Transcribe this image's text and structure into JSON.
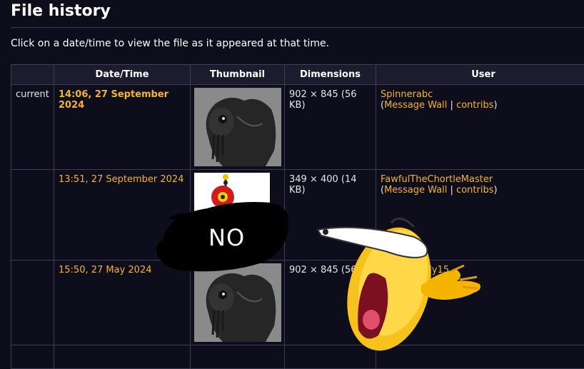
{
  "page": {
    "heading": "File history",
    "intro": "Click on a date/time to view the file as it appeared at that time."
  },
  "table": {
    "headers": [
      "",
      "Date/Time",
      "Thumbnail",
      "Dimensions",
      "User"
    ],
    "rows": [
      {
        "status": "current",
        "datetime": "14:06, 27 September 2024",
        "dimensions": "902 × 845 (56 KB)",
        "user": "Spinnerabc",
        "open_paren": "(",
        "message_wall": "Message Wall",
        "sep": "|",
        "contribs": "contribs",
        "close_paren": ")"
      },
      {
        "status": "",
        "datetime": "13:51, 27 September 2024",
        "dimensions": "349 × 400 (14 KB)",
        "user": "FawfulTheChortleMaster",
        "open_paren": "(",
        "message_wall": "Message Wall",
        "sep": "|",
        "contribs": "contribs",
        "close_paren": ")"
      },
      {
        "status": "",
        "datetime": "15:50, 27 May 2024",
        "dimensions": "902 × 845 (56",
        "user": "gly15",
        "open_paren": "",
        "message_wall": "",
        "sep": "",
        "contribs": "",
        "close_paren": ""
      }
    ]
  },
  "overlay": {
    "no_text": "NO"
  },
  "colors": {
    "background": "#0e0d1c",
    "link": "#f4b42a",
    "header_bg": "#1d1c2e",
    "border": "#3e3d55"
  }
}
